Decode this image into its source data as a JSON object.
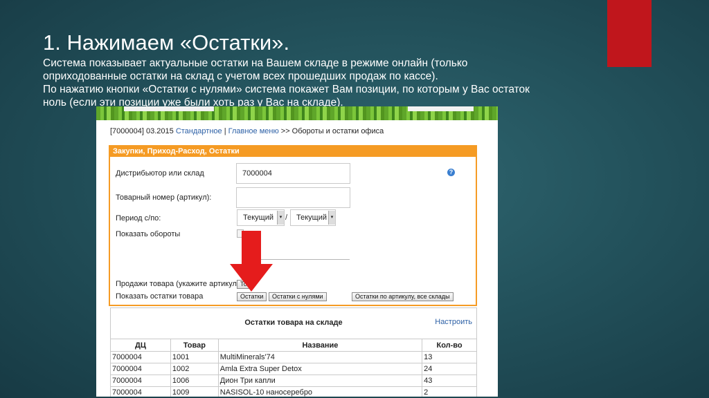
{
  "colors": {
    "background": "#23525c",
    "accent_red": "#c0161c",
    "panel_orange": "#f59b24",
    "link_blue": "#2b5fa5",
    "arrow_red": "#e51c1c"
  },
  "slide": {
    "title": "1. Нажимаем «Остатки».",
    "lines": [
      "Система показывает актуальные остатки на Вашем складе в режиме онлайн (только",
      "оприходованные остатки на склад с учетом всех прошедших продаж по кассе).",
      "По нажатию кнопки «Остатки с нулями» система покажет Вам позиции, по которым у Вас остаток",
      "ноль (если эти позиции уже были хоть раз у Вас на складе)."
    ]
  },
  "screenshot": {
    "breadcrumb": {
      "prefix": "[7000004] 03.2015",
      "link1": "Стандартное",
      "sep1": "|",
      "link2": "Главное меню",
      "tail": ">> Обороты и остатки офиса"
    },
    "panel": {
      "title": "Закупки, Приход-Расход, Остатки",
      "distributor_label": "Дистрибьютор или склад",
      "distributor_value": "7000004",
      "article_label": "Товарный номер (артикул):",
      "article_value": "",
      "period_label": "Период с/по:",
      "period_from": "Текущий",
      "period_to": "Текущий",
      "period_sep": "/",
      "turnover_label": "Показать обороты",
      "sales_label": "Продажи товара (укажите артикул)",
      "sales_button": "То",
      "stock_label": "Показать остатки товара",
      "btn_stock": "Остатки",
      "btn_stock_zero": "Остатки с нулями",
      "btn_stock_all": "Остатки по артикулу, все склады",
      "help_icon": "question-circle-icon",
      "help_glyph": "?",
      "arrow_glyph": "▾"
    },
    "results": {
      "title": "Остатки товара на складе",
      "configure": "Настроить",
      "columns": [
        "ДЦ",
        "Товар",
        "Название",
        "Кол-во"
      ],
      "rows": [
        [
          "7000004",
          "1001",
          "MultiMinerals'74",
          "13"
        ],
        [
          "7000004",
          "1002",
          "Amla Extra Super Detox",
          "24"
        ],
        [
          "7000004",
          "1006",
          "Дион Три капли",
          "43"
        ],
        [
          "7000004",
          "1009",
          "NASISOL-10 наносеребро",
          "2"
        ]
      ]
    }
  }
}
